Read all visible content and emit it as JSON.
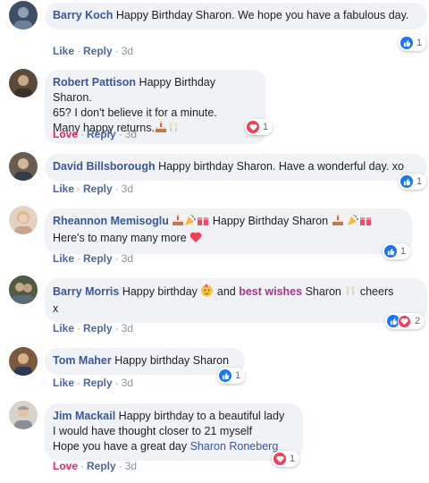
{
  "comments": [
    {
      "author": "Barry Koch",
      "text": "Happy Birthday Sharon. We hope you have a fabulous day.",
      "reaction": "Like",
      "reply": "Reply",
      "time": "3d",
      "reactions": {
        "icons": [
          "like-icon"
        ],
        "count": "1"
      },
      "avatar_color": "#3d4f66"
    },
    {
      "author": "Robert Pattison",
      "lines": [
        "Happy Birthday Sharon.",
        "65? I don't believe it for a minute.",
        "Many happy returns."
      ],
      "emoji": [
        "birthday-cake-icon",
        "clinking-glasses-icon"
      ],
      "reaction": "Love",
      "reply": "Reply",
      "time": "3d",
      "reactions": {
        "icons": [
          "heart-icon"
        ],
        "count": "1"
      },
      "avatar_color": "#5a4a3c"
    },
    {
      "author": "David Billsborough",
      "text": "Happy birthday Sharon. Have a wonderful day. xo",
      "reaction": "Like",
      "reply": "Reply",
      "time": "3d",
      "reactions": {
        "icons": [
          "like-icon"
        ],
        "count": "1"
      },
      "avatar_color": "#6b5c4e"
    },
    {
      "author": "Rheannon Memisoglu",
      "text_a": "Happy Birthday Sharon",
      "text_b": "Here's to many many more",
      "emoji": [
        "birthday-cake-icon",
        "party-popper-icon",
        "gift-icon",
        "red-heart-icon"
      ],
      "reaction": "Like",
      "reply": "Reply",
      "time": "3d",
      "reactions": {
        "icons": [
          "like-icon"
        ],
        "count": "1"
      },
      "avatar_color": "#c9a48a"
    },
    {
      "author": "Barry Morris",
      "text_a": "Happy birthday",
      "text_b": "and",
      "highlight": "best wishes",
      "text_c": "Sharon",
      "text_d": "cheers",
      "text_e": "x",
      "emoji": [
        "partying-face-icon",
        "clinking-glasses-icon"
      ],
      "reaction": "Like",
      "reply": "Reply",
      "time": "3d",
      "reactions": {
        "icons": [
          "like-icon",
          "heart-icon"
        ],
        "count": "2"
      },
      "avatar_color": "#4f5a3e"
    },
    {
      "author": "Tom Maher",
      "text": "Happy birthday Sharon",
      "reaction": "Like",
      "reply": "Reply",
      "time": "3d",
      "reactions": {
        "icons": [
          "like-icon"
        ],
        "count": "1"
      },
      "avatar_color": "#7a5a3e"
    },
    {
      "author": "Jim Mackail",
      "lines": [
        "Happy birthday to a beautiful lady",
        "I would have thought closer to 21 myself",
        "Hope you have a great day"
      ],
      "mention": "Sharon Roneberg",
      "reaction": "Love",
      "reply": "Reply",
      "time": "3d",
      "reactions": {
        "icons": [
          "heart-icon"
        ],
        "count": "1"
      },
      "avatar_color": "#b7b1a8"
    }
  ],
  "separator": "·"
}
